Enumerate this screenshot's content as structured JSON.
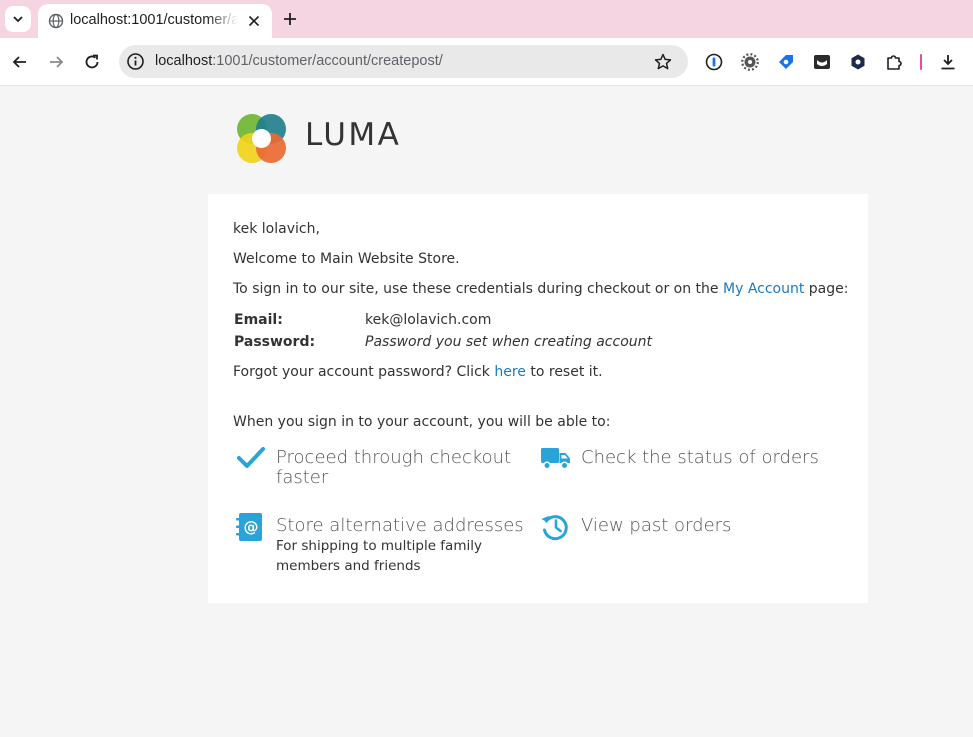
{
  "browser": {
    "tab_title": "localhost:1001/customer/account/createpost/",
    "url_host": "localhost",
    "url_rest": ":1001/customer/account/createpost/"
  },
  "email": {
    "greeting": "kek lolavich,",
    "welcome": "Welcome to Main Website Store.",
    "signin_prefix": "To sign in to our site, use these credentials during checkout or on the",
    "signin_link": "My Account",
    "signin_suffix": "page:",
    "email_label": "Email:",
    "email_value": "kek@lolavich.com",
    "password_label": "Password:",
    "password_value": "Password you set when creating account",
    "forgot_prefix": "Forgot your account password? Click",
    "forgot_link": "here",
    "forgot_suffix": "to reset it.",
    "benefits_intro": "When you sign in to your account, you will be able to:",
    "features": [
      {
        "title_line1": "Proceed through checkout",
        "title_line2": "faster"
      },
      {
        "title_line1": "Check the status of orders"
      },
      {
        "title_line1": "Store alternative addresses",
        "sub_line1": "For shipping to multiple family",
        "sub_line2": "members and friends"
      },
      {
        "title_line1": "View past orders"
      }
    ]
  },
  "logo": {
    "text": "LUMA"
  },
  "colors": {
    "accent": "#1979c3",
    "icon_blue": "#2aa3d9",
    "tab_strip": "#f6d5e3"
  }
}
